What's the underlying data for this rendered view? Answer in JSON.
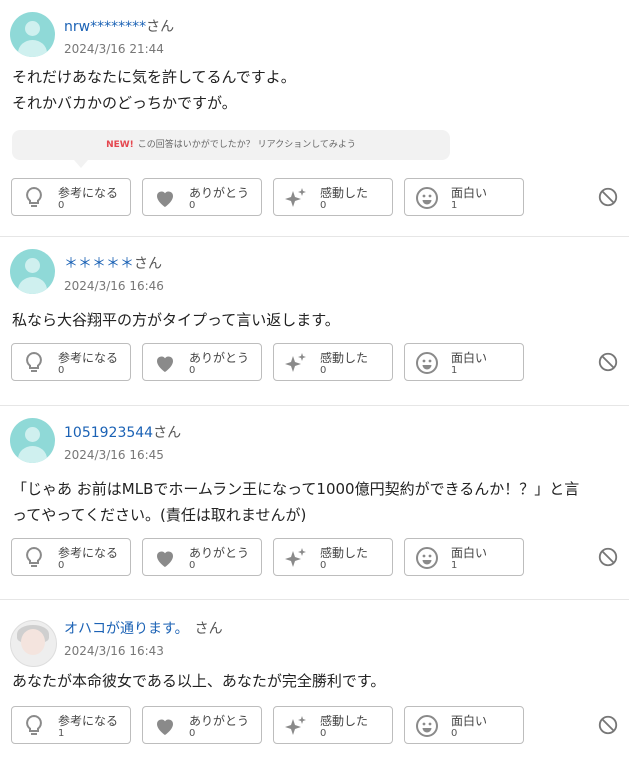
{
  "answers": [
    {
      "name": "nrw********",
      "suffix": "さん",
      "date": "2024/3/16 21:44",
      "lines": [
        "それだけあなたに気を許してるんですよ。",
        "それかバカかのどっちかですが。"
      ],
      "promo": {
        "badge": "NEW!",
        "text": "この回答はいかがでしたか？ リアクションしてみよう"
      },
      "reactions": [
        {
          "label": "参考になる",
          "count": "0"
        },
        {
          "label": "ありがとう",
          "count": "0"
        },
        {
          "label": "感動した",
          "count": "0"
        },
        {
          "label": "面白い",
          "count": "1"
        }
      ]
    },
    {
      "name": "＊＊＊＊＊",
      "suffix": "さん",
      "date": "2024/3/16 16:46",
      "lines": [
        "私なら大谷翔平の方がタイプって言い返します。"
      ],
      "reactions": [
        {
          "label": "参考になる",
          "count": "0"
        },
        {
          "label": "ありがとう",
          "count": "0"
        },
        {
          "label": "感動した",
          "count": "0"
        },
        {
          "label": "面白い",
          "count": "1"
        }
      ]
    },
    {
      "name": "1051923544",
      "suffix": "さん",
      "date": "2024/3/16 16:45",
      "lines": [
        "「じゃあ お前はMLBでホームラン王になって1000億円契約ができるんか！？」と言",
        "ってやってください。(責任は取れませんが)"
      ],
      "reactions": [
        {
          "label": "参考になる",
          "count": "0"
        },
        {
          "label": "ありがとう",
          "count": "0"
        },
        {
          "label": "感動した",
          "count": "0"
        },
        {
          "label": "面白い",
          "count": "1"
        }
      ]
    },
    {
      "name": "オハコが通ります。",
      "suffix": "さん",
      "date": "2024/3/16 16:43",
      "lines": [
        "あなたが本命彼女である以上、あなたが完全勝利です。"
      ],
      "reactions": [
        {
          "label": "参考になる",
          "count": "1"
        },
        {
          "label": "ありがとう",
          "count": "0"
        },
        {
          "label": "感動した",
          "count": "0"
        },
        {
          "label": "面白い",
          "count": "0"
        }
      ]
    }
  ],
  "icons": {
    "reactions": [
      "lightbulb-icon",
      "heart-icon",
      "sparkle-icon",
      "smile-icon"
    ],
    "block": "block-icon"
  },
  "colors": {
    "username": "#1b62b5",
    "new_badge": "#e5474f",
    "icon_gray": "#8a8a8a"
  }
}
